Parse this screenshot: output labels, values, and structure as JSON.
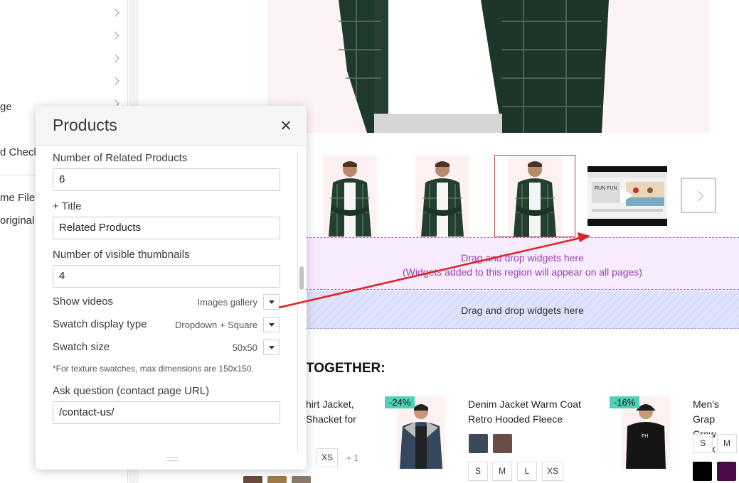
{
  "sidebar": {
    "items": [
      {
        "label": ""
      },
      {
        "label": ""
      },
      {
        "label": ""
      },
      {
        "label": ""
      },
      {
        "label": "ge"
      },
      {
        "label": "d Checkout"
      }
    ],
    "files_label": "me Files",
    "original_label": "original t"
  },
  "preview": {
    "dropzone1_line1": "Drag and drop widgets here",
    "dropzone1_line2": "(Widgets added to this region will appear on all pages)",
    "dropzone2_text": "Drag and drop widgets here",
    "section_title": "TOGETHER:",
    "products": [
      {
        "name_line1": "hirt Jacket,",
        "name_line2": "Shacket for",
        "sizes": [
          "XS"
        ],
        "more": "+ 1",
        "swatches": [
          "#6a4a3a",
          "#9c7a4a",
          "#8a7a6a"
        ]
      },
      {
        "name_line1": "Denim Jacket Warm Coat",
        "name_line2": "Retro Hooded Fleece",
        "discount": "-24%",
        "swatches": [
          "#3a4a5a",
          "#6a4d44"
        ],
        "sizes": [
          "S",
          "M",
          "L",
          "XS"
        ]
      },
      {
        "name_line1": "Men's Grap",
        "name_line2": "Crew Neck",
        "discount": "-16%",
        "sizes": [
          "S",
          "M"
        ],
        "swatches": [
          "#000000",
          "#4a0a4a"
        ]
      }
    ],
    "video_brand": "RUN FUN"
  },
  "panel": {
    "title": "Products",
    "related_label": "Number of Related Products",
    "related_value": "6",
    "title_label": "+ Title",
    "title_value": "Related Products",
    "thumbs_label": "Number of visible thumbnails",
    "thumbs_value": "4",
    "show_videos_label": "Show videos",
    "show_videos_value": "Images gallery",
    "swatch_type_label": "Swatch display type",
    "swatch_type_value": "Dropdown + Square",
    "swatch_size_label": "Swatch size",
    "swatch_size_value": "50x50",
    "note": "*For texture swatches, max dimensions are 150x150.",
    "ask_label": "Ask question (contact page URL)",
    "ask_value": "/contact-us/"
  },
  "colors": {
    "accent_arrow": "#e02020",
    "discount_badge": "#4fd1b6",
    "active_thumb_border": "#b04a4a",
    "dropzone_text": "#9b3fb0"
  }
}
